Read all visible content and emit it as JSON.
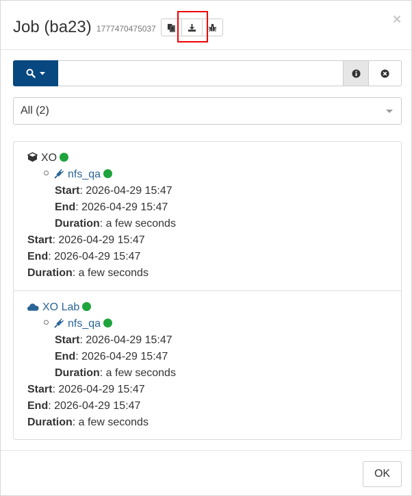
{
  "modal": {
    "title": "Job (ba23)",
    "job_id": "1777470475037",
    "close_label": "×",
    "ok_label": "OK"
  },
  "toolbar": {
    "copy_icon": "copy-icon",
    "download_icon": "download-icon",
    "bug_icon": "bug-icon"
  },
  "search": {
    "value": "",
    "placeholder": ""
  },
  "filter": {
    "selected": "All (2)"
  },
  "entries": [
    {
      "icon": "cube-icon",
      "name": "XO",
      "status_color": "#1fa33c",
      "task": {
        "icon": "plug-icon",
        "name": "nfs_qa",
        "start_label": "Start",
        "start": ": 2026-04-29 15:47",
        "end_label": "End",
        "end": ": 2026-04-29 15:47",
        "duration_label": "Duration",
        "duration": ": a few seconds"
      },
      "start_label": "Start",
      "start": ": 2026-04-29 15:47",
      "end_label": "End",
      "end": ": 2026-04-29 15:47",
      "duration_label": "Duration",
      "duration": ": a few seconds"
    },
    {
      "icon": "cloud-icon",
      "name": "XO Lab",
      "status_color": "#1fa33c",
      "task": {
        "icon": "plug-icon",
        "name": "nfs_qa",
        "start_label": "Start",
        "start": ": 2026-04-29 15:47",
        "end_label": "End",
        "end": ": 2026-04-29 15:47",
        "duration_label": "Duration",
        "duration": ": a few seconds"
      },
      "start_label": "Start",
      "start": ": 2026-04-29 15:47",
      "end_label": "End",
      "end": ": 2026-04-29 15:47",
      "duration_label": "Duration",
      "duration": ": a few seconds"
    }
  ],
  "colors": {
    "primary": "#084880",
    "link": "#2a6496",
    "success": "#1fa33c",
    "highlight": "#ee0000"
  }
}
